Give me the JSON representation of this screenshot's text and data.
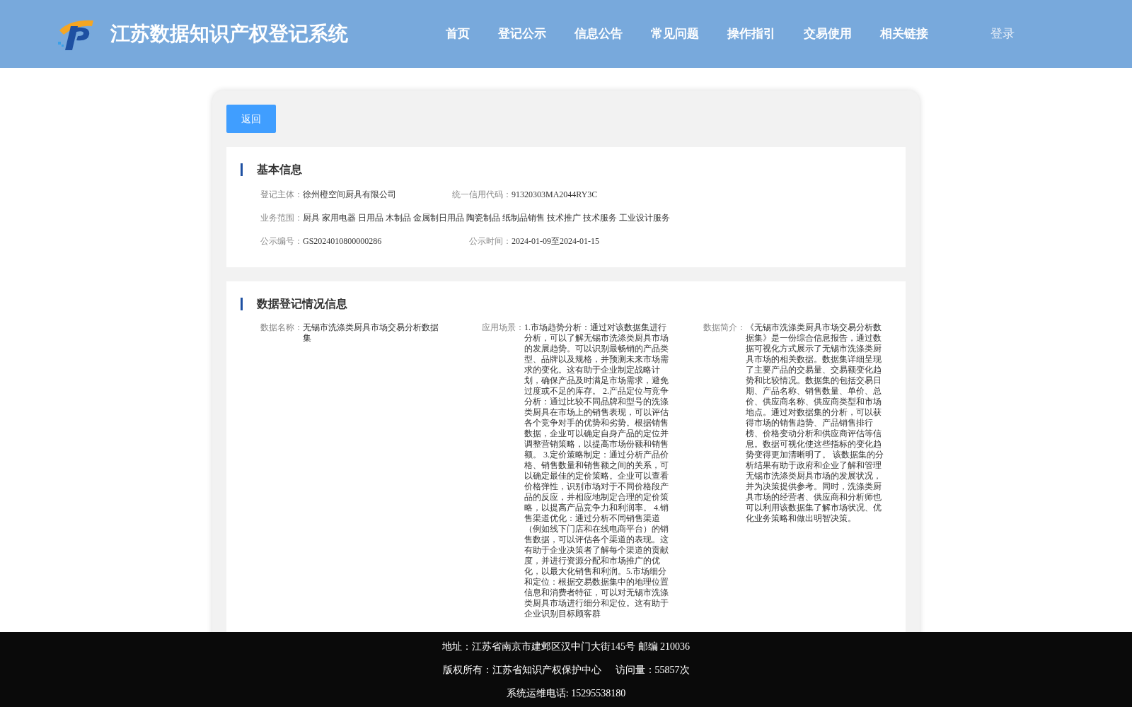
{
  "header": {
    "title": "江苏数据知识产权登记系统",
    "nav": [
      {
        "label": "首页",
        "selected": false
      },
      {
        "label": "登记公示",
        "selected": false
      },
      {
        "label": "信息公告",
        "selected": false
      },
      {
        "label": "常见问题",
        "selected": false
      },
      {
        "label": "操作指引",
        "selected": false
      },
      {
        "label": "交易使用",
        "selected": false
      },
      {
        "label": "相关链接",
        "selected": false
      }
    ],
    "login": "登录"
  },
  "back_button": "返回",
  "basic_info": {
    "title": "基本信息",
    "rows": [
      [
        {
          "label": "登记主体：",
          "value": "徐州橙空间厨具有限公司"
        },
        {
          "label": "统一信用代码：",
          "value": "91320303MA2044RY3C"
        }
      ],
      [
        {
          "label": "业务范围：",
          "value": "厨具 家用电器 日用品 木制品 金属制日用品 陶瓷制品 纸制品销售 技术推广 技术服务 工业设计服务"
        }
      ],
      [
        {
          "label": "公示编号：",
          "value": "GS2024010800000286"
        },
        {
          "label": "公示时间：",
          "value": "2024-01-09至2024-01-15"
        }
      ]
    ]
  },
  "data_info": {
    "title": "数据登记情况信息",
    "fields": [
      {
        "label": "数据名称：",
        "value": "无锡市洗涤类厨具市场交易分析数据集"
      },
      {
        "label": "应用场景：",
        "value": "1.市场趋势分析：通过对该数据集进行分析，可以了解无锡市洗涤类厨具市场的发展趋势。可以识别最畅销的产品类型、品牌以及规格，并预测未来市场需求的变化。这有助于企业制定战略计划，确保产品及时满足市场需求，避免过度或不足的库存。 2.产品定位与竞争分析：通过比较不同品牌和型号的洗涤类厨具在市场上的销售表现，可以评估各个竞争对手的优势和劣势。根据销售数据，企业可以确定自身产品的定位并调整营销策略，以提高市场份额和销售额。 3.定价策略制定：通过分析产品价格、销售数量和销售额之间的关系，可以确定最佳的定价策略。企业可以查看价格弹性，识别市场对于不同价格段产品的反应，并相应地制定合理的定价策略，以提高产品竞争力和利润率。 4.销售渠道优化：通过分析不同销售渠道（例如线下门店和在线电商平台）的销售数据，可以评估各个渠道的表现。这有助于企业决策者了解每个渠道的贡献度，并进行资源分配和市场推广的优化，以最大化销售和利润。5.市场细分和定位：根据交易数据集中的地理位置信息和消费者特征，可以对无锡市洗涤类厨具市场进行细分和定位。这有助于企业识别目标顾客群"
      },
      {
        "label": "数据简介：",
        "value": "《无锡市洗涤类厨具市场交易分析数据集》是一份综合信息报告，通过数据可视化方式展示了无锡市洗涤类厨具市场的相关数据。数据集详细呈现了主要产品的交易量、交易额变化趋势和比较情况。数据集的包括交易日期、产品名称、销售数量、单价、总价、供应商名称、供应商类型和市场地点。通过对数据集的分析，可以获得市场的销售趋势、产品销售排行榜、价格变动分析和供应商评估等信息。数据可视化使这些指标的变化趋势变得更加清晰明了。 该数据集的分析结果有助于政府和企业了解和管理无锡市洗涤类厨具市场的发展状况，并为决策提供参考。同时，洗涤类厨具市场的经营者、供应商和分析师也可以利用该数据集了解市场状况、优化业务策略和做出明智决策。"
      }
    ]
  },
  "footer": {
    "lines": [
      "地址：江苏省南京市建邺区汉中门大街145号 邮编 210036",
      "版权所有：江苏省知识产权保护中心",
      "访问量：55857次",
      "系统运维电话: 15295538180"
    ]
  }
}
